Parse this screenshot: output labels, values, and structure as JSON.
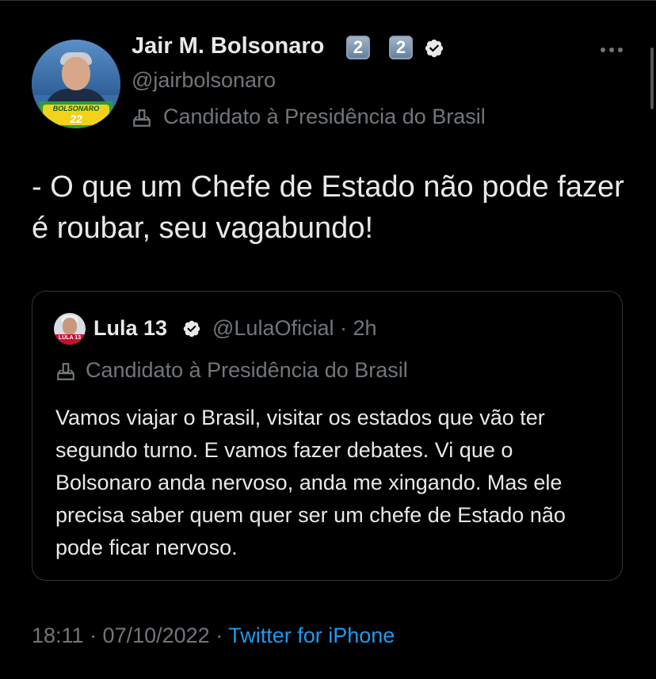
{
  "author": {
    "name": "Jair M. Bolsonaro",
    "keycaps": [
      "2",
      "2"
    ],
    "handle": "@jairbolsonaro",
    "label": "Candidato à Presidência do Brasil",
    "avatar_text": {
      "brand": "BOLSONARO",
      "number": "22"
    }
  },
  "tweet": {
    "text": "- O que um Chefe de Estado não pode fazer é roubar, seu vagabundo!"
  },
  "quoted": {
    "name": "Lula 13",
    "handle_time": "@LulaOficial · 2h",
    "label": "Candidato à Presidência do Brasil",
    "avatar_text": "LULA 13",
    "text": "Vamos viajar o Brasil, visitar os estados que vão ter segundo turno. E vamos fazer debates. Vi que o Bolsonaro anda nervoso, anda me xingando. Mas ele precisa saber quem quer ser um chefe de Estado não pode ficar nervoso."
  },
  "meta": {
    "timestamp": "18:11 · 07/10/2022 · ",
    "source": "Twitter for iPhone"
  },
  "icons": {
    "verified": "verified-badge-icon",
    "more": "more-horizontal-icon",
    "label": "ballot-box-icon"
  },
  "colors": {
    "background": "#000000",
    "text": "#e7e9ea",
    "secondary": "#71767b",
    "link": "#1d9bf0",
    "border": "#2f3336"
  }
}
